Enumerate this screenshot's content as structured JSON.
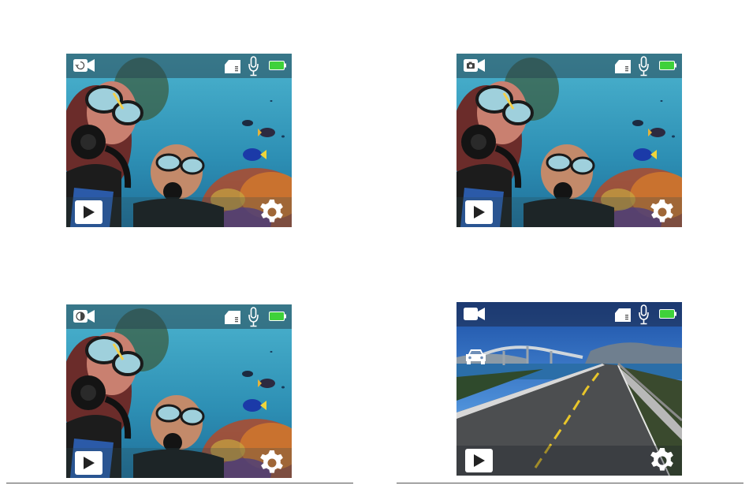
{
  "screens": [
    {
      "id": "video-loop",
      "mode_icon": "video-loop-icon",
      "scene": "underwater"
    },
    {
      "id": "video-photo",
      "mode_icon": "video-photo-icon",
      "scene": "underwater"
    },
    {
      "id": "video-timelapse",
      "mode_icon": "video-timelapse-icon",
      "scene": "underwater"
    },
    {
      "id": "video-car",
      "mode_icon": "video-icon",
      "scene": "road",
      "extra_icon": "car-mode-icon"
    }
  ],
  "status_icons": [
    "sd-card-icon",
    "microphone-icon",
    "battery-icon"
  ],
  "controls": [
    "play-icon",
    "settings-gear-icon"
  ],
  "colors": {
    "battery": "#3fd13a",
    "icon": "#ffffff",
    "rule": "#555555"
  }
}
